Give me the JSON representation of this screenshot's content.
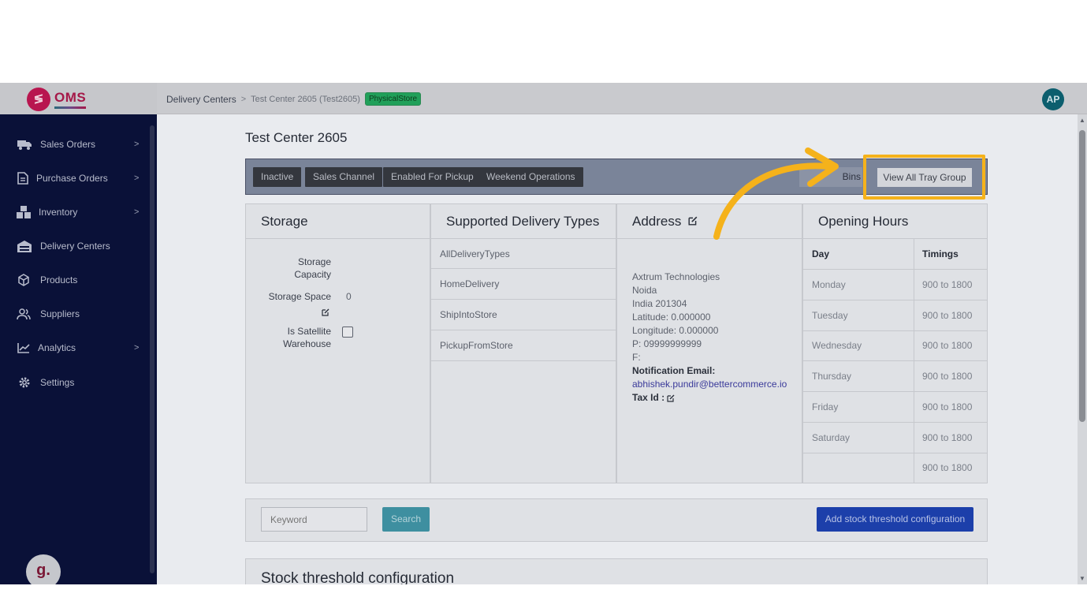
{
  "app": {
    "logo_text": "OMS",
    "avatar_initials": "AP",
    "g_logo": "g."
  },
  "breadcrumb": {
    "root": "Delivery Centers",
    "separator": ">",
    "current": "Test Center 2605 (Test2605)",
    "badge": "PhysicalStore"
  },
  "sidebar": {
    "items": [
      {
        "label": "Sales Orders",
        "icon": "truck-icon",
        "has_children": true
      },
      {
        "label": "Purchase Orders",
        "icon": "document-icon",
        "has_children": true
      },
      {
        "label": "Inventory",
        "icon": "boxes-icon",
        "has_children": true
      },
      {
        "label": "Delivery Centers",
        "icon": "warehouse-icon",
        "has_children": false
      },
      {
        "label": "Products",
        "icon": "package-icon",
        "has_children": false
      },
      {
        "label": "Suppliers",
        "icon": "users-icon",
        "has_children": false
      },
      {
        "label": "Analytics",
        "icon": "chart-line-icon",
        "has_children": true
      },
      {
        "label": "Settings",
        "icon": "gear-icon",
        "has_children": false
      }
    ],
    "chevron": ">",
    "collapse": "«"
  },
  "page": {
    "title": "Test Center 2605",
    "actions": [
      "Inactive",
      "Sales Channel",
      "Enabled For Pickup",
      "Weekend Operations"
    ],
    "bins_label": "Bins",
    "tray_label": "View All Tray Group"
  },
  "storage": {
    "title": "Storage",
    "capacity_label": "Storage Capacity",
    "space_label": "Storage Space",
    "space_value": "0",
    "satellite_label": "Is Satellite Warehouse",
    "satellite_checked": false
  },
  "delivery_types": {
    "title": "Supported Delivery Types",
    "items": [
      "AllDeliveryTypes",
      "HomeDelivery",
      "ShipIntoStore",
      "PickupFromStore"
    ]
  },
  "address": {
    "title": "Address",
    "company": "Axtrum Technologies",
    "city": "Noida",
    "country_zip": "India 201304",
    "latitude": "Latitude: 0.000000",
    "longitude": "Longitude: 0.000000",
    "phone": "P: 09999999999",
    "fax": "F:",
    "notification_label": "Notification Email:",
    "email": "abhishek.pundir@bettercommerce.io",
    "tax_label": "Tax Id :"
  },
  "hours": {
    "title": "Opening Hours",
    "day_header": "Day",
    "timing_header": "Timings",
    "rows": [
      {
        "day": "Monday",
        "time": "900 to 1800"
      },
      {
        "day": "Tuesday",
        "time": "900 to 1800"
      },
      {
        "day": "Wednesday",
        "time": "900 to 1800"
      },
      {
        "day": "Thursday",
        "time": "900 to 1800"
      },
      {
        "day": "Friday",
        "time": "900 to 1800"
      },
      {
        "day": "Saturday",
        "time": "900 to 1800"
      },
      {
        "day": "",
        "time": "900 to 1800"
      }
    ]
  },
  "search": {
    "placeholder": "Keyword",
    "button": "Search",
    "add_button": "Add stock threshold configuration"
  },
  "threshold": {
    "title": "Stock threshold configuration"
  },
  "colors": {
    "sidebar_bg": "#0a1138",
    "brand": "#a51848",
    "primary_button": "#1c3faa",
    "search_button": "#3e8fa0",
    "highlight": "#f5b21b"
  }
}
